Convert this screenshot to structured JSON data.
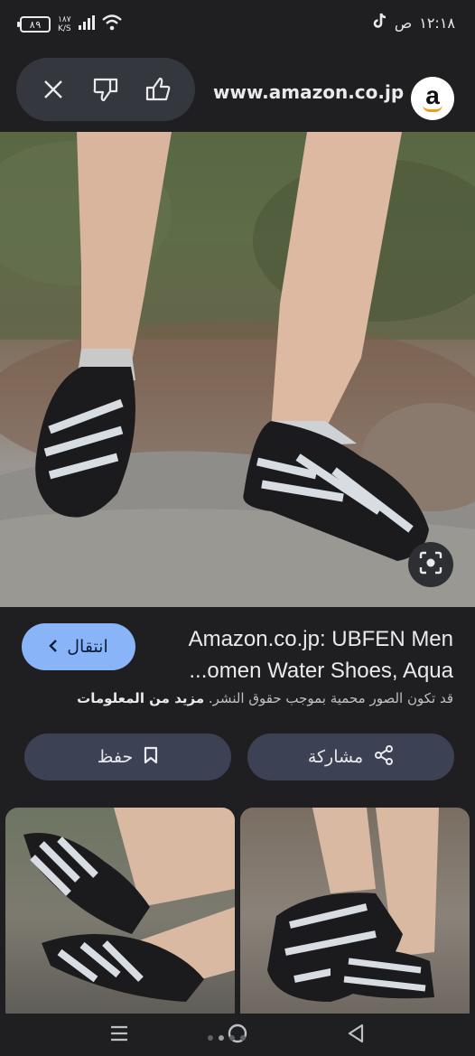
{
  "status_bar": {
    "battery": "٨٩",
    "net_speed_value": "١٨٧",
    "net_speed_unit": "K/S",
    "time": "١٢:١٨",
    "time_suffix": "ص"
  },
  "header": {
    "domain": "www.amazon.co.jp",
    "logo_letter": "a",
    "icons": [
      "close-icon",
      "thumbs-down-icon",
      "thumbs-up-icon"
    ]
  },
  "result": {
    "visit_label": "انتقال",
    "title_line1": "Amazon.co.jp: UBFEN Men",
    "title_line2": "...omen Water Shoes, Aqua",
    "copyright_text": "قد تكون الصور محمية بموجب حقوق النشر.",
    "more_info": "مزيد من المعلومات"
  },
  "actions": {
    "save_label": "حفظ",
    "share_label": "مشاركة"
  },
  "navbar": {
    "icons": [
      "menu-icon",
      "home-icon",
      "back-icon"
    ]
  },
  "colors": {
    "background": "#1f1f21",
    "accent": "#8ab4f8",
    "pill": "#3c4253"
  }
}
